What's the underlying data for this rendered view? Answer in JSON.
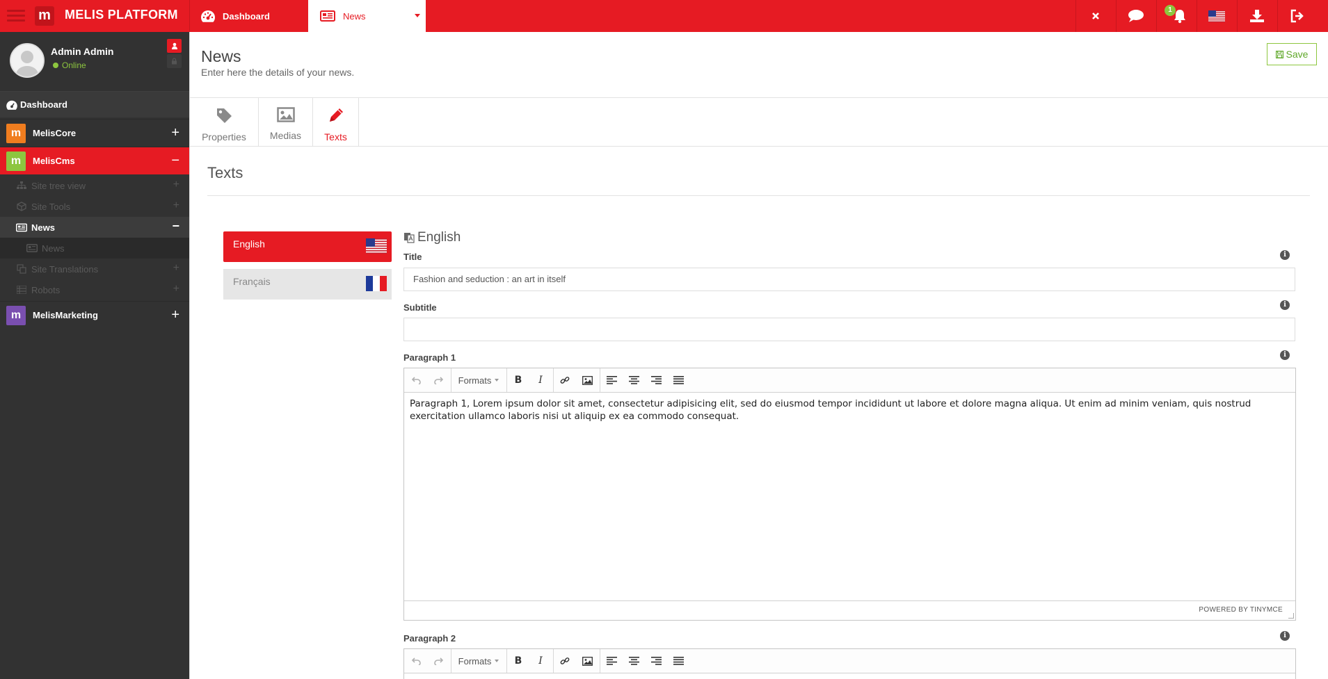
{
  "topbar": {
    "brand": "MELIS PLATFORM",
    "logo_letter": "m",
    "tabs": [
      {
        "label": "Dashboard",
        "icon": "dashboard-icon"
      },
      {
        "label": "News",
        "icon": "newspaper-icon"
      }
    ],
    "notification_count": "1",
    "icons": [
      "close-icon",
      "chat-icon",
      "bell-icon",
      "us-flag-icon",
      "download-icon",
      "logout-icon"
    ]
  },
  "sidebar": {
    "user": {
      "name": "Admin Admin",
      "status": "Online"
    },
    "dashboard_label": "Dashboard",
    "modules": [
      {
        "label": "MelisCore",
        "color": "#f07d1f",
        "expanded": false
      },
      {
        "label": "MelisCms",
        "color": "#8dc63f",
        "expanded": true
      },
      {
        "label": "MelisMarketing",
        "color": "#7a4fb0",
        "expanded": false
      }
    ],
    "cms_items": [
      {
        "label": "Site tree view",
        "icon": "sitemap-icon"
      },
      {
        "label": "Site Tools",
        "icon": "cube-icon"
      },
      {
        "label": "News",
        "icon": "newspaper-icon",
        "active": true
      },
      {
        "label": "News",
        "icon": "newspaper-icon",
        "sub": true
      },
      {
        "label": "Site Translations",
        "icon": "translate-icon"
      },
      {
        "label": "Robots",
        "icon": "list-icon"
      }
    ]
  },
  "header": {
    "title": "News",
    "subtitle": "Enter here the details of your news.",
    "save_label": "Save"
  },
  "tabs": [
    {
      "label": "Properties",
      "icon": "tag-icon"
    },
    {
      "label": "Medias",
      "icon": "image-icon"
    },
    {
      "label": "Texts",
      "icon": "pencil-icon",
      "active": true
    }
  ],
  "section_title": "Texts",
  "languages": [
    {
      "label": "English",
      "active": true,
      "flag": "us-flag"
    },
    {
      "label": "Français",
      "active": false,
      "flag": "fr-flag"
    }
  ],
  "form": {
    "language_heading": "English",
    "title_label": "Title",
    "title_value": "Fashion and seduction : an art in itself",
    "subtitle_label": "Subtitle",
    "subtitle_value": "",
    "paragraph1_label": "Paragraph 1",
    "paragraph1_text": "Paragraph 1, Lorem ipsum dolor sit amet, consectetur adipisicing elit, sed do eiusmod tempor incididunt ut labore et dolore magna aliqua. Ut enim ad minim veniam, quis nostrud exercitation ullamco laboris nisi ut aliquip ex ea commodo consequat.",
    "paragraph2_label": "Paragraph 2",
    "formats_label": "Formats",
    "editor_footer": "POWERED BY TINYMCE"
  }
}
